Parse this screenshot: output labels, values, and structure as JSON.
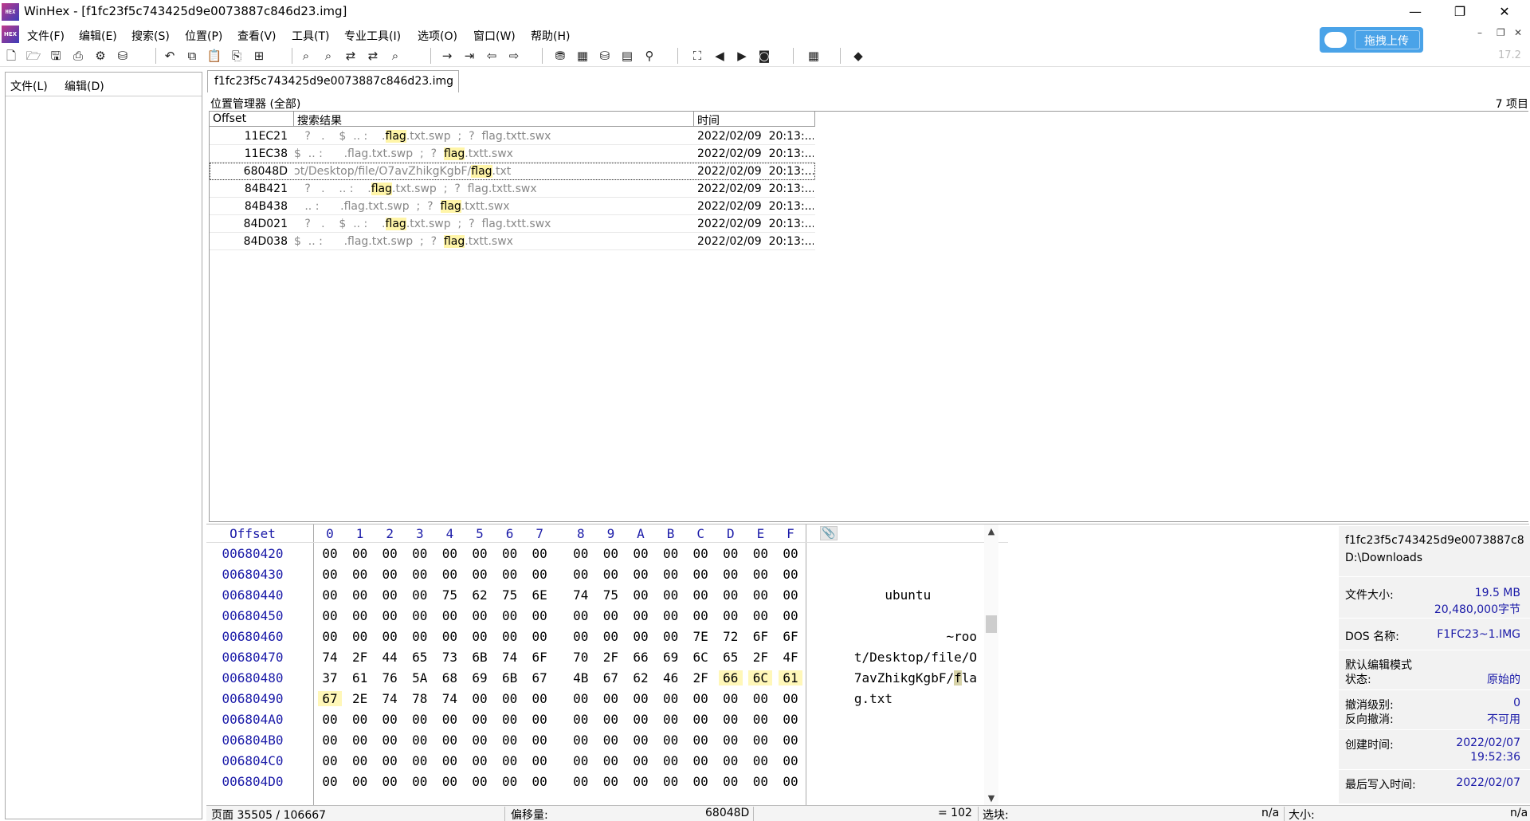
{
  "window": {
    "title": "WinHex - [f1fc23f5c743425d9e0073887c846d23.img]",
    "logo_text": "HEX",
    "min_glyph": "—",
    "max_glyph": "❐",
    "close_glyph": "✕"
  },
  "menu": [
    "文件(F)",
    "编辑(E)",
    "搜索(S)",
    "位置(P)",
    "查看(V)",
    "工具(T)",
    "专业工具(I)",
    "选项(O)",
    "窗口(W)",
    "帮助(H)"
  ],
  "upload_button": "拖拽上传",
  "mdi_controls": [
    "–",
    "❐",
    "✕"
  ],
  "version": "17.2",
  "left_pane": {
    "menu": [
      "文件(L)",
      "编辑(D)"
    ]
  },
  "file_tab": "f1fc23f5c743425d9e0073887c846d23.img",
  "position_manager": {
    "title": "位置管理器 (全部)",
    "count": "7 项目",
    "columns": [
      "Offset",
      "搜索结果",
      "时间"
    ],
    "rows": [
      {
        "offset": "11EC21",
        "pre": "   ?   .    $  .. :    .",
        "hit": "flag",
        "post": ".txt.swp  ;  ?  flag.txtt.swx",
        "time": "2022/02/09  20:13:..."
      },
      {
        "offset": "11EC38",
        "pre": "$  .. :      .flag.txt.swp  ;  ?  ",
        "hit": "flag",
        "post": ".txtt.swx",
        "time": "2022/02/09  20:13:..."
      },
      {
        "offset": "68048D",
        "pre": "ɔt/Desktop/file/O7avZhikgKgbF/",
        "hit": "flag",
        "post": ".txt",
        "time": "2022/02/09  20:13:..."
      },
      {
        "offset": "84B421",
        "pre": "   ?   .    .. :    .",
        "hit": "flag",
        "post": ".txt.swp  ;  ?  flag.txtt.swx",
        "time": "2022/02/09  20:13:..."
      },
      {
        "offset": "84B438",
        "pre": "   .. :      .flag.txt.swp  ;  ?  ",
        "hit": "flag",
        "post": ".txtt.swx",
        "time": "2022/02/09  20:13:..."
      },
      {
        "offset": "84D021",
        "pre": "   ?   .    $  .. :    .",
        "hit": "flag",
        "post": ".txt.swp  ;  ?  flag.txtt.swx",
        "time": "2022/02/09  20:13:..."
      },
      {
        "offset": "84D038",
        "pre": "$  .. :      .flag.txt.swp  ;  ?  ",
        "hit": "flag",
        "post": ".txtt.swx",
        "time": "2022/02/09  20:13:..."
      }
    ]
  },
  "hex": {
    "offset_header": "Offset",
    "columns": [
      "0",
      "1",
      "2",
      "3",
      "4",
      "5",
      "6",
      "7",
      "8",
      "9",
      "A",
      "B",
      "C",
      "D",
      "E",
      "F"
    ],
    "rows": [
      {
        "offset": "00680420",
        "bytes": [
          "00",
          "00",
          "00",
          "00",
          "00",
          "00",
          "00",
          "00",
          "00",
          "00",
          "00",
          "00",
          "00",
          "00",
          "00",
          "00"
        ],
        "a_pre": "",
        "a_hl": "",
        "a_post": ""
      },
      {
        "offset": "00680430",
        "bytes": [
          "00",
          "00",
          "00",
          "00",
          "00",
          "00",
          "00",
          "00",
          "00",
          "00",
          "00",
          "00",
          "00",
          "00",
          "00",
          "00"
        ],
        "a_pre": "",
        "a_hl": "",
        "a_post": ""
      },
      {
        "offset": "00680440",
        "bytes": [
          "00",
          "00",
          "00",
          "00",
          "75",
          "62",
          "75",
          "6E",
          "74",
          "75",
          "00",
          "00",
          "00",
          "00",
          "00",
          "00"
        ],
        "a_pre": "ubuntu      ",
        "a_hl": "",
        "a_post": ""
      },
      {
        "offset": "00680450",
        "bytes": [
          "00",
          "00",
          "00",
          "00",
          "00",
          "00",
          "00",
          "00",
          "00",
          "00",
          "00",
          "00",
          "00",
          "00",
          "00",
          "00"
        ],
        "a_pre": "",
        "a_hl": "",
        "a_post": ""
      },
      {
        "offset": "00680460",
        "bytes": [
          "00",
          "00",
          "00",
          "00",
          "00",
          "00",
          "00",
          "00",
          "00",
          "00",
          "00",
          "00",
          "7E",
          "72",
          "6F",
          "6F"
        ],
        "a_pre": "~roo",
        "a_hl": "",
        "a_post": ""
      },
      {
        "offset": "00680470",
        "bytes": [
          "74",
          "2F",
          "44",
          "65",
          "73",
          "6B",
          "74",
          "6F",
          "70",
          "2F",
          "66",
          "69",
          "6C",
          "65",
          "2F",
          "4F"
        ],
        "a_pre": "t/Desktop/file/O",
        "a_hl": "",
        "a_post": ""
      },
      {
        "offset": "00680480",
        "bytes": [
          "37",
          "61",
          "76",
          "5A",
          "68",
          "69",
          "6B",
          "67",
          "4B",
          "67",
          "62",
          "46",
          "2F",
          "66",
          "6C",
          "61"
        ],
        "a_pre": "7avZhikgKgbF/",
        "a_hl": "f",
        "a_post": "la"
      },
      {
        "offset": "00680490",
        "bytes": [
          "67",
          "2E",
          "74",
          "78",
          "74",
          "00",
          "00",
          "00",
          "00",
          "00",
          "00",
          "00",
          "00",
          "00",
          "00",
          "00"
        ],
        "a_pre": "g.txt           ",
        "a_hl": "",
        "a_post": ""
      },
      {
        "offset": "006804A0",
        "bytes": [
          "00",
          "00",
          "00",
          "00",
          "00",
          "00",
          "00",
          "00",
          "00",
          "00",
          "00",
          "00",
          "00",
          "00",
          "00",
          "00"
        ],
        "a_pre": "",
        "a_hl": "",
        "a_post": ""
      },
      {
        "offset": "006804B0",
        "bytes": [
          "00",
          "00",
          "00",
          "00",
          "00",
          "00",
          "00",
          "00",
          "00",
          "00",
          "00",
          "00",
          "00",
          "00",
          "00",
          "00"
        ],
        "a_pre": "",
        "a_hl": "",
        "a_post": ""
      },
      {
        "offset": "006804C0",
        "bytes": [
          "00",
          "00",
          "00",
          "00",
          "00",
          "00",
          "00",
          "00",
          "00",
          "00",
          "00",
          "00",
          "00",
          "00",
          "00",
          "00"
        ],
        "a_pre": "",
        "a_hl": "",
        "a_post": ""
      },
      {
        "offset": "006804D0",
        "bytes": [
          "00",
          "00",
          "00",
          "00",
          "00",
          "00",
          "00",
          "00",
          "00",
          "00",
          "00",
          "00",
          "00",
          "00",
          "00",
          "00"
        ],
        "a_pre": "",
        "a_hl": "",
        "a_post": ""
      }
    ],
    "highlight": {
      "6": [
        13,
        14,
        15
      ],
      "7": [
        0
      ]
    },
    "attach_glyph": "📎"
  },
  "info": {
    "file_name": "f1fc23f5c743425d9e0073887c8",
    "folder": "D:\\Downloads",
    "size_label": "文件大小:",
    "size_mb": "19.5 MB",
    "size_bytes": "20,480,000字节",
    "dos_label": "DOS 名称:",
    "dos_name": "F1FC23~1.IMG",
    "edit_mode_label": "默认编辑模式",
    "state_label": "状态:",
    "state_value": "原始的",
    "undo_label": "撤消级别:",
    "undo_value": "0",
    "reverse_label": "反向撤消:",
    "reverse_value": "不可用",
    "created_label": "创建时间:",
    "created_date": "2022/02/07",
    "created_time": "19:52:36",
    "written_label": "最后写入时间:",
    "written_date": "2022/02/07"
  },
  "status": {
    "page": "页面 35505 / 106667",
    "offset_label": "偏移量:",
    "offset_value": "68048D",
    "equals": "= 102",
    "selection_label": "选块:",
    "selection_value": "n/a",
    "size_label": "大小:",
    "size_value": "n/a"
  },
  "colors": {
    "offset_blue": "#1a1aa8",
    "highlight": "#fff7b8",
    "upload_blue": "#4aa3e8"
  }
}
